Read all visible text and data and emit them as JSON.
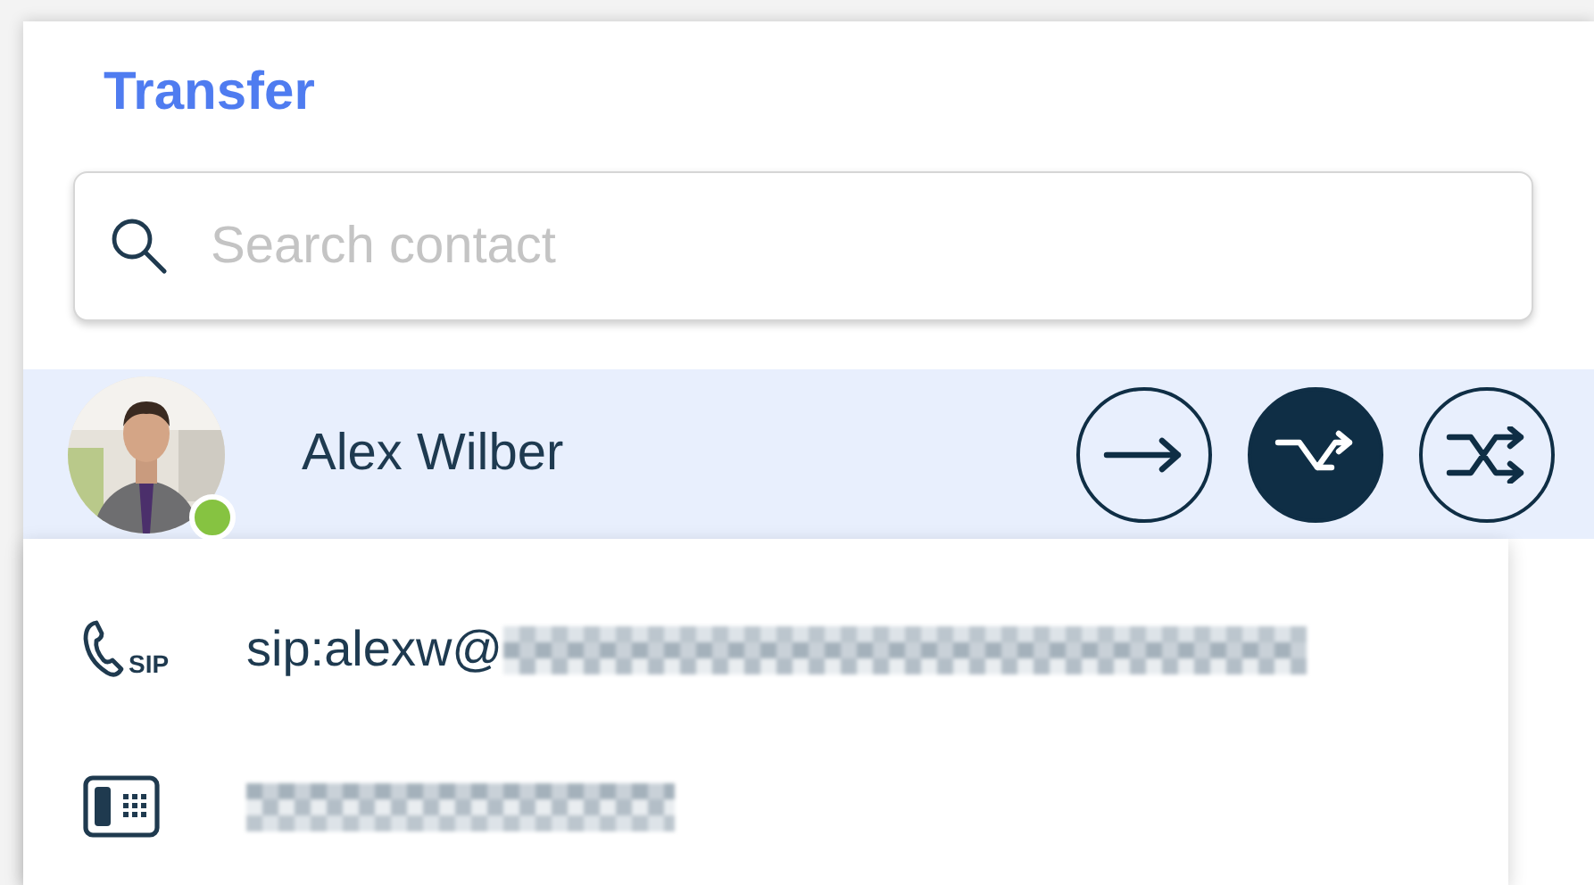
{
  "title": "Transfer",
  "search": {
    "placeholder": "Search contact"
  },
  "contact": {
    "name": "Alex Wilber",
    "online": true,
    "selected": true,
    "actions": [
      {
        "kind": "transfer",
        "selected": false
      },
      {
        "kind": "consult",
        "selected": true
      },
      {
        "kind": "merge",
        "selected": false
      }
    ]
  },
  "details": [
    {
      "kind": "sip",
      "icon_label": "SIP",
      "value": "sip:alexw@",
      "redacted": true
    },
    {
      "kind": "phone",
      "redacted": true
    }
  ]
}
